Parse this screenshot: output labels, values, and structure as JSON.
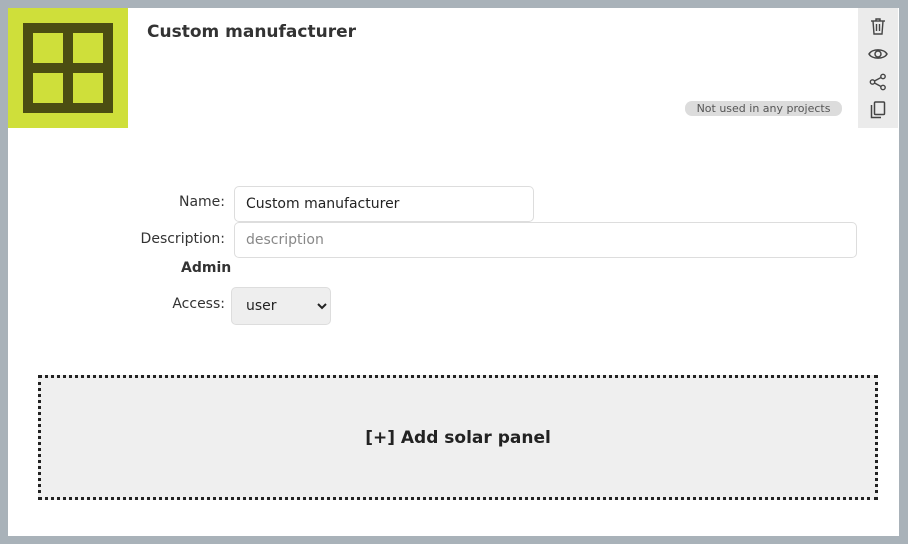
{
  "header": {
    "title": "Custom manufacturer",
    "usage_badge": "Not used in any projects",
    "logo_icon": "window-grid-icon",
    "colors": {
      "logo_background": "#cfdf3a",
      "logo_foreground": "#4b4d12"
    }
  },
  "toolbar": {
    "items": [
      {
        "icon": "trash-icon"
      },
      {
        "icon": "eye-icon"
      },
      {
        "icon": "share-icon"
      },
      {
        "icon": "copy-icon"
      }
    ]
  },
  "form": {
    "name_label": "Name:",
    "name_value": "Custom manufacturer",
    "description_label": "Description:",
    "description_placeholder": "description",
    "description_value": "",
    "admin_heading": "Admin",
    "access_label": "Access:",
    "access_value": "user"
  },
  "add_panel": {
    "label": "[+] Add solar panel"
  }
}
